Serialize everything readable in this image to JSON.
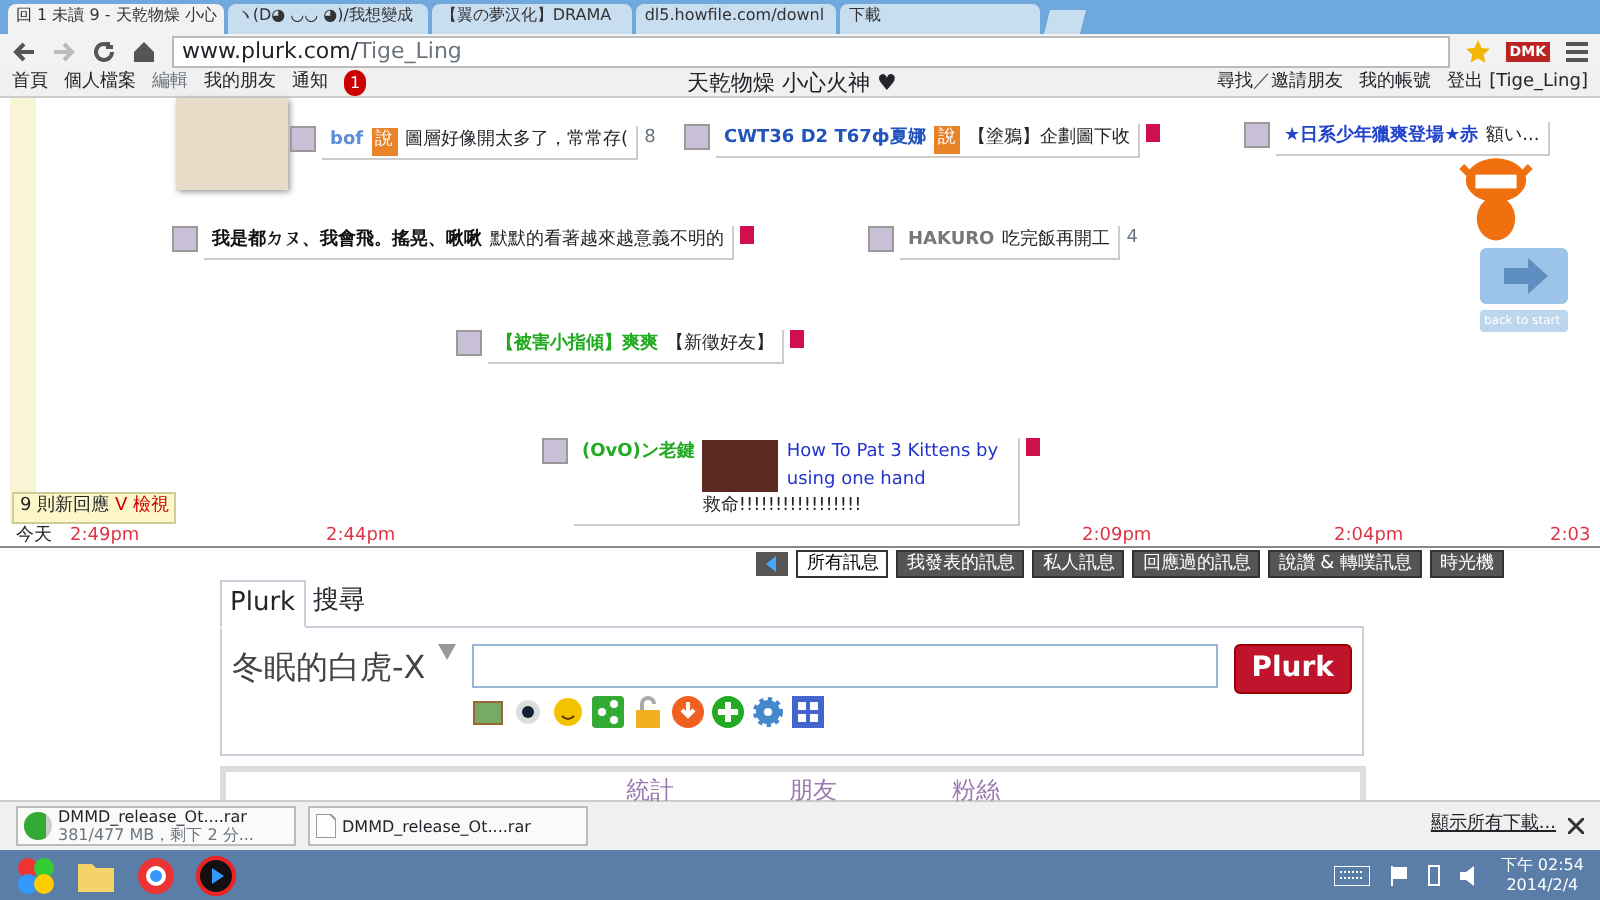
{
  "browser": {
    "tabs": [
      {
        "title": "回 1 未讀 9 - 天乾物燥 小心",
        "selected": true
      },
      {
        "title": "ヽ(D◕ ◡◡ ◕)/我想變成",
        "selected": false
      },
      {
        "title": "【翼の夢汉化】DRAMA",
        "selected": false
      },
      {
        "title": "dl5.howfile.com/downl",
        "selected": false
      },
      {
        "title": "下載",
        "selected": false
      }
    ],
    "address": {
      "host": "www.plurk.com/",
      "path": "Tige_Ling"
    },
    "extension_label": "DMK"
  },
  "nav": {
    "left": [
      {
        "label": "首頁",
        "kind": "link"
      },
      {
        "label": "個人檔案",
        "kind": "link"
      },
      {
        "label": "編輯",
        "kind": "plain"
      },
      {
        "label": "我的朋友",
        "kind": "link"
      },
      {
        "label": "通知",
        "kind": "link"
      }
    ],
    "notification_count": "1",
    "title": "天乾物燥 小心火神 ♥",
    "right": [
      "尋找／邀請朋友",
      "我的帳號",
      "登出 [Tige_Ling]"
    ]
  },
  "timeline": {
    "plurks": [
      {
        "author": "bof",
        "color": "#5b8fd6",
        "qualifier": "說",
        "text": "圖層好像開太多了，常常存(",
        "count": "8",
        "unread": false
      },
      {
        "author": "CWT36 D2 T67ф夏娜",
        "color": "#2255bb",
        "qualifier": "說",
        "text": "【塗鴉】企劃圖下收",
        "unread": true
      },
      {
        "author": "★日系少年獵爽登場★赤",
        "color": "#2244cc",
        "text": "額い...",
        "unread": false
      },
      {
        "author": "我是都ㄉㄡ、我會飛。搖晃、啾啾",
        "color": "#111111",
        "text": "默默的看著越來越意義不明的",
        "unread": true
      },
      {
        "author": "HAKURO",
        "color": "#777777",
        "text": "吃完飯再開工",
        "count": "4",
        "unread": false
      },
      {
        "author": "【被害小指傾】爽爽",
        "color": "#22aa22",
        "text": "【新徵好友】",
        "unread": true
      },
      {
        "author": "(OvO)ン老鍵",
        "color": "#22aa22",
        "link": "How To Pat 3 Kittens by using one hand",
        "text": "救命!!!!!!!!!!!!!!!!!",
        "unread": true
      }
    ],
    "new_responses": {
      "count_text": "9 則新回應",
      "action": "V 檢視"
    },
    "back_label": "back to start",
    "time_labels": [
      "今天",
      "2:49pm",
      "2:44pm",
      "2:09pm",
      "2:04pm",
      "2:03"
    ],
    "filters": [
      {
        "label": "所有訊息",
        "selected": true
      },
      {
        "label": "我發表的訊息",
        "selected": false
      },
      {
        "label": "私人訊息",
        "selected": false
      },
      {
        "label": "回應過的訊息",
        "selected": false
      },
      {
        "label": "說讚 & 轉噗訊息",
        "selected": false
      },
      {
        "label": "時光機",
        "selected": false
      }
    ]
  },
  "composer": {
    "tabs": [
      {
        "label": "Plurk",
        "selected": true
      },
      {
        "label": "搜尋",
        "selected": false
      }
    ],
    "user": "冬眠的白虎-X",
    "button": "Plurk"
  },
  "stats": [
    "統計",
    "朋友",
    "粉絲"
  ],
  "downloads": {
    "items": [
      {
        "name": "DMMD_release_Ot....rar",
        "status": "381/477 MB，剩下 2 分...",
        "kind": "progress",
        "level": 0.8
      },
      {
        "name": "DMMD_release_Ot....rar",
        "kind": "file"
      }
    ],
    "show_all": "顯示所有下載..."
  },
  "taskbar": {
    "time": "下午 02:54",
    "date": "2014/2/4"
  }
}
